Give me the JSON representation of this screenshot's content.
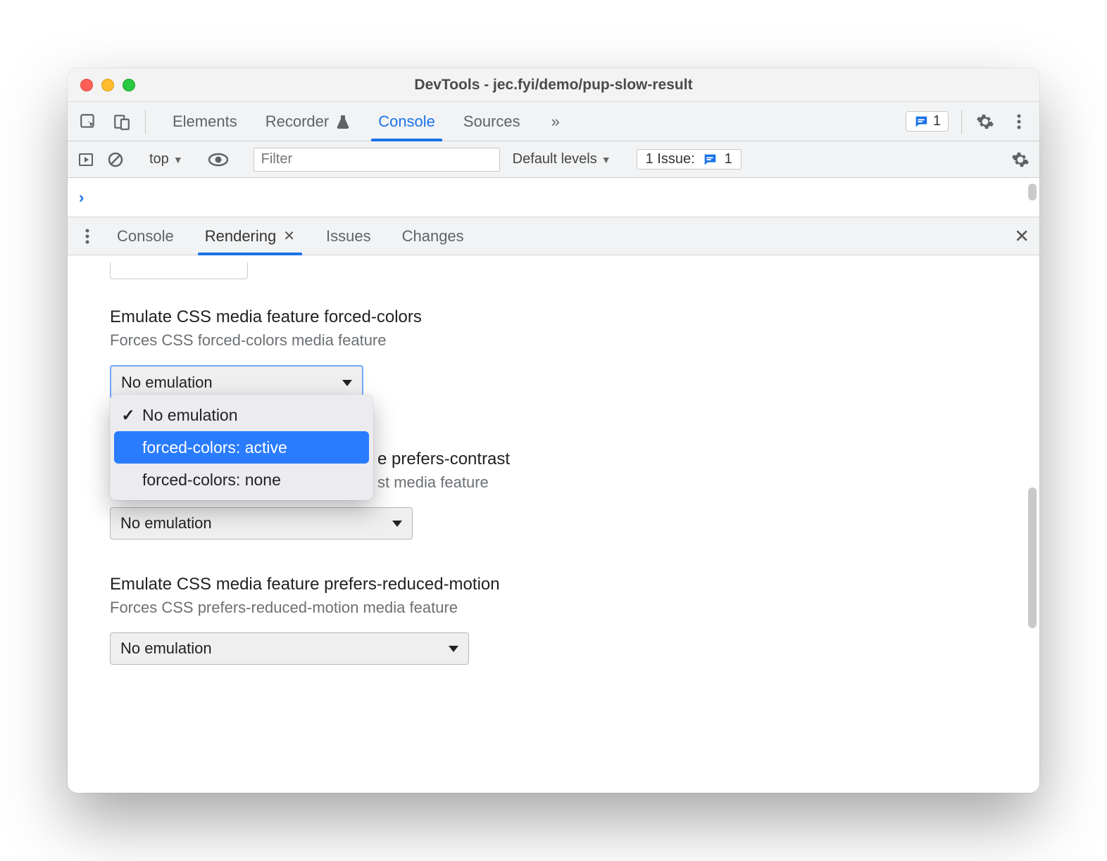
{
  "window": {
    "title": "DevTools - jec.fyi/demo/pup-slow-result"
  },
  "main_tabs": {
    "elements": "Elements",
    "recorder": "Recorder",
    "console": "Console",
    "sources": "Sources"
  },
  "toolbar": {
    "issues_badge_count": "1"
  },
  "console_toolbar": {
    "context_label": "top",
    "filter_placeholder": "Filter",
    "levels_label": "Default levels",
    "issues_prefix": "1 Issue:",
    "issues_count": "1"
  },
  "drawer_tabs": {
    "console": "Console",
    "rendering": "Rendering",
    "issues": "Issues",
    "changes": "Changes"
  },
  "rendering": {
    "forced_colors": {
      "title": "Emulate CSS media feature forced-colors",
      "desc": "Forces CSS forced-colors media feature",
      "selected": "No emulation",
      "options": {
        "none": "No emulation",
        "active": "forced-colors: active",
        "fc_none": "forced-colors: none"
      }
    },
    "prefers_contrast": {
      "title_partial": "e prefers-contrast",
      "desc_partial": "st media feature",
      "selected_partial": "No emulation"
    },
    "prefers_reduced_motion": {
      "title": "Emulate CSS media feature prefers-reduced-motion",
      "desc": "Forces CSS prefers-reduced-motion media feature",
      "selected": "No emulation"
    }
  }
}
